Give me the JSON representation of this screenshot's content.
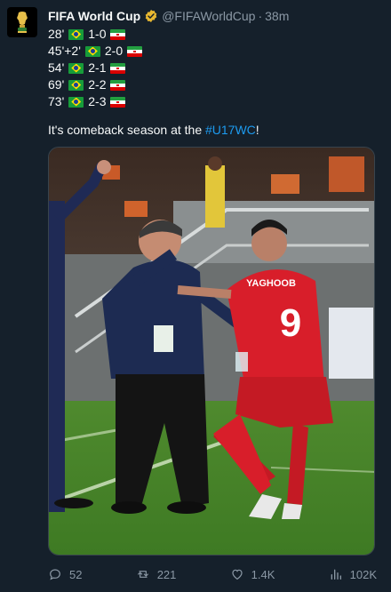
{
  "account": {
    "name": "FIFA World Cup",
    "handle": "@FIFAWorldCup",
    "separator": "·",
    "time": "38m",
    "avatar_icon": "fifa-world-cup-trophy-logo",
    "verified_color": "#e8b831"
  },
  "scoreline": [
    {
      "minute": "28'",
      "score": "1-0"
    },
    {
      "minute": "45'+2'",
      "score": "2-0"
    },
    {
      "minute": "54'",
      "score": "2-1"
    },
    {
      "minute": "69'",
      "score": "2-2"
    },
    {
      "minute": "73'",
      "score": "2-3"
    }
  ],
  "tweet": {
    "text_before": "It's comeback season at the ",
    "hashtag": "#U17WC",
    "text_after": "!"
  },
  "media": {
    "jersey_name": "YAGHOOB",
    "jersey_number": "9"
  },
  "actions": {
    "reply_count": "52",
    "retweet_count": "221",
    "like_count": "1.4K",
    "views_count": "102K"
  },
  "colors": {
    "background": "#15202b",
    "text": "#f7f9f9",
    "muted": "#8b98a5",
    "link": "#1d9bf0"
  }
}
